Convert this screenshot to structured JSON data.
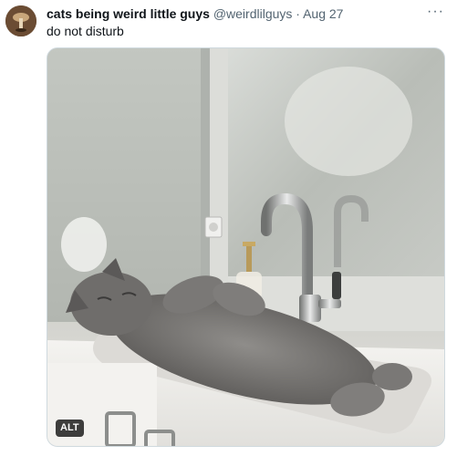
{
  "tweet": {
    "display_name": "cats being weird little guys",
    "handle": "@weirdlilguys",
    "separator": "·",
    "date": "Aug 27",
    "more": "···",
    "text": "do not disturb"
  },
  "media": {
    "alt_label": "ALT",
    "icons": [
      "avatar",
      "more-options-icon"
    ]
  }
}
